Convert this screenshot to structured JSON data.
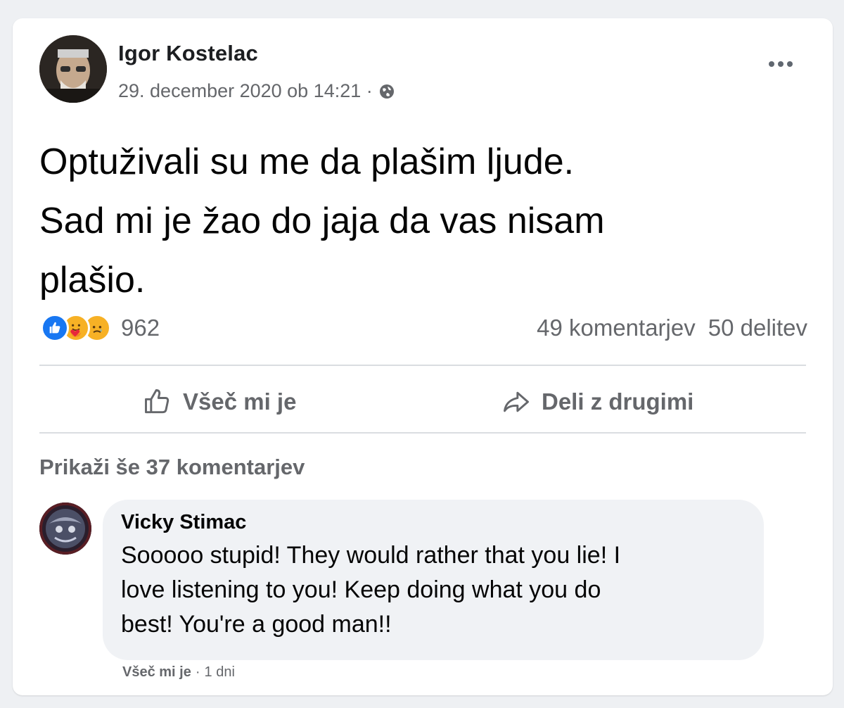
{
  "post": {
    "author": "Igor Kostelac",
    "timestamp": "29. december 2020 ob 14:21 ·",
    "privacy_icon": "globe-icon",
    "lines": [
      "Optuživali su me da plašim ljude.",
      "Sad mi je žao do jaja da vas nisam",
      "plašio."
    ],
    "reactions": {
      "types": [
        "like",
        "care",
        "sad"
      ],
      "count": "962"
    },
    "comments_count": "49 komentarjev",
    "shares_count": "50 delitev"
  },
  "actions": {
    "like_label": "Všeč mi je",
    "share_label": "Deli z drugimi"
  },
  "comments": {
    "more_label": "Prikaži še 37 komentarjev",
    "items": [
      {
        "author": "Vicky Stimac",
        "lines": [
          "Sooooo stupid! They would rather that you lie! I",
          "love listening to you! Keep doing what you do",
          "best! You're a good man!!"
        ],
        "like_label": "Všeč mi je",
        "separator": "·",
        "time": "1 dni"
      }
    ]
  },
  "colors": {
    "background": "#eef0f3",
    "card": "#ffffff",
    "muted_text": "#65676b",
    "like_blue": "#1877f2",
    "reaction_yellow": "#f7b125",
    "bubble": "#f0f2f5"
  }
}
